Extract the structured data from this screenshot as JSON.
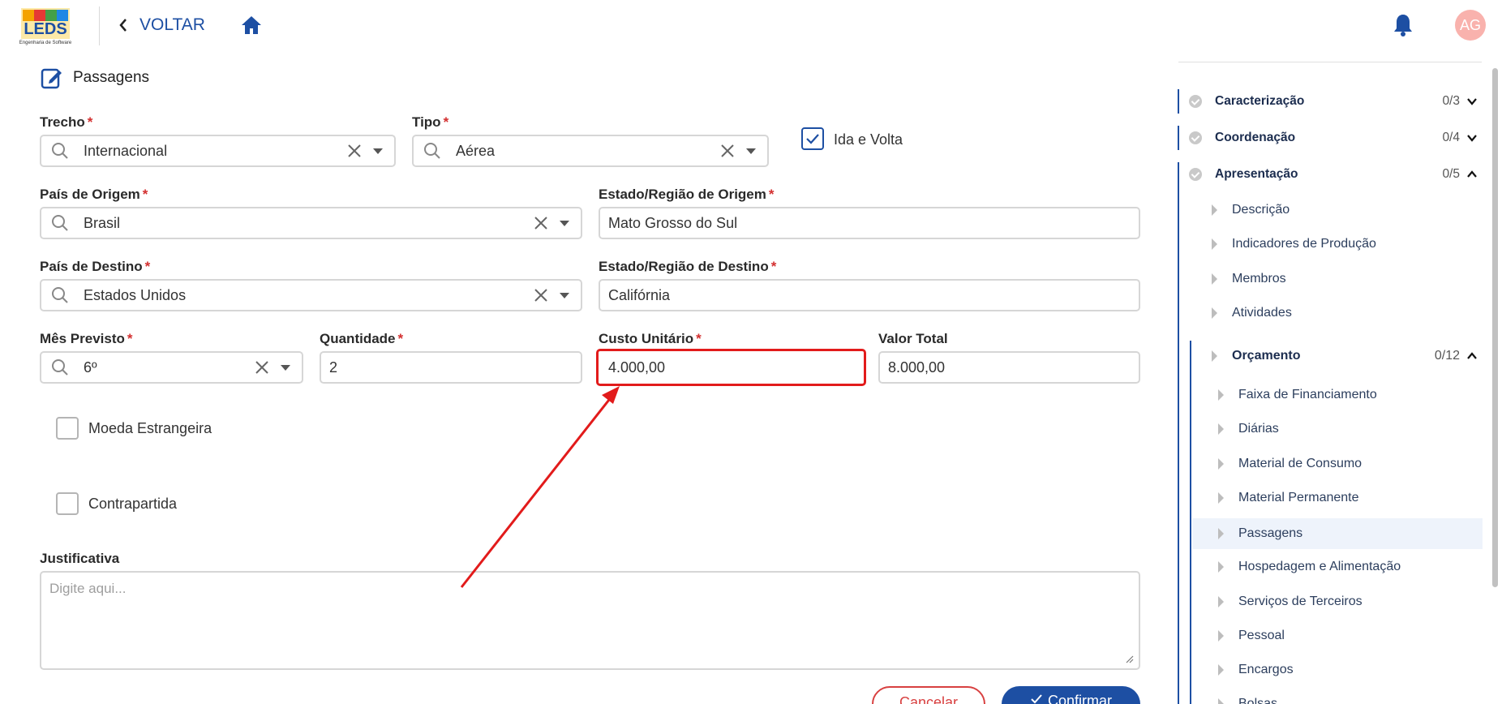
{
  "header": {
    "logo_text": "LEDS",
    "logo_subtext": "Engenharia de Software",
    "back_label": "VOLTAR",
    "avatar_initials": "AG",
    "accent_color": "#1d4fa3"
  },
  "form": {
    "section_title": "Passagens",
    "trecho": {
      "label": "Trecho",
      "value": "Internacional"
    },
    "tipo": {
      "label": "Tipo",
      "value": "Aérea"
    },
    "ida_volta": {
      "label": "Ida e Volta",
      "checked": true
    },
    "pais_origem": {
      "label": "País de Origem",
      "value": "Brasil"
    },
    "estado_origem": {
      "label": "Estado/Região de Origem",
      "value": "Mato Grosso do Sul"
    },
    "pais_destino": {
      "label": "País de Destino",
      "value": "Estados Unidos"
    },
    "estado_destino": {
      "label": "Estado/Região de Destino",
      "value": "Califórnia"
    },
    "mes_previsto": {
      "label": "Mês Previsto",
      "value": "6º"
    },
    "quantidade": {
      "label": "Quantidade",
      "value": "2"
    },
    "custo_unitario": {
      "label": "Custo Unitário",
      "value": "4.000,00"
    },
    "valor_total": {
      "label": "Valor Total",
      "value": "8.000,00"
    },
    "moeda_estrangeira": {
      "label": "Moeda Estrangeira",
      "checked": false
    },
    "contrapartida": {
      "label": "Contrapartida",
      "checked": false
    },
    "justificativa": {
      "label": "Justificativa",
      "placeholder": "Digite aqui..."
    },
    "required_mark": "*",
    "cancel_label": "Cancelar",
    "confirm_label": "Confirmar"
  },
  "sidebar": {
    "sections": [
      {
        "name": "Caracterização",
        "count": "0/3",
        "expanded": false
      },
      {
        "name": "Coordenação",
        "count": "0/4",
        "expanded": false
      },
      {
        "name": "Apresentação",
        "count": "0/5",
        "expanded": true
      }
    ],
    "apresentacao_items": [
      "Descrição",
      "Indicadores de Produção",
      "Membros",
      "Atividades"
    ],
    "orcamento": {
      "name": "Orçamento",
      "count": "0/12",
      "expanded": true
    },
    "orcamento_items": [
      "Faixa de Financiamento",
      "Diárias",
      "Material de Consumo",
      "Material Permanente",
      "Passagens",
      "Hospedagem e Alimentação",
      "Serviços de Terceiros",
      "Pessoal",
      "Encargos",
      "Bolsas"
    ],
    "active_item": "Passagens"
  },
  "annotation": {
    "color": "#e21b1b",
    "target": "custo-unitario-field"
  }
}
